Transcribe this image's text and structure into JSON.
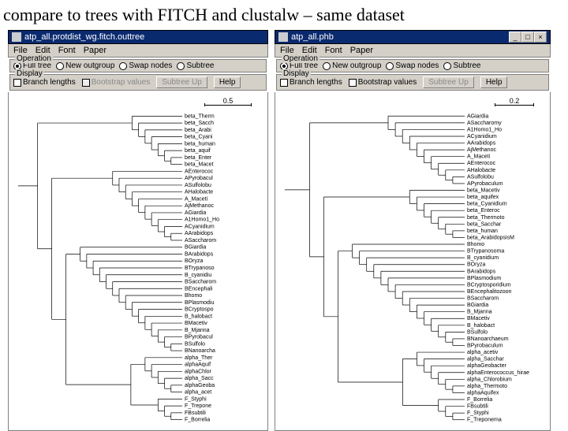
{
  "slide": {
    "title": "compare to trees with FITCH and clustalw – same dataset"
  },
  "left": {
    "titlebar": "atp_all.protdist_wg.fitch.outtree",
    "menu": [
      "File",
      "Edit",
      "Font",
      "Paper"
    ],
    "op_legend": "Operation",
    "ops": [
      "Full tree",
      "New outgroup",
      "Swap nodes",
      "Subtree"
    ],
    "op_sel": 0,
    "disp_legend": "Display",
    "branch_lbl": "Branch lengths",
    "boot_lbl": "Bootstrap values",
    "btn_up": "Subtree Up",
    "btn_help": "Help",
    "scale": "0.5",
    "taxa": [
      "beta_Therm",
      "beta_Sacch",
      "beta_Arabi",
      "beta_Cyani",
      "beta_human",
      "beta_aquif",
      "beta_Enter",
      "beta_Macet",
      "AEnterococ",
      "APyrobacul",
      "ASulfolobu",
      "AHalobacte",
      "A_Maceti",
      "AjMethanoc",
      "AGiardia",
      "A1Homo1_Ho",
      "ACyanidium",
      "AArabidops",
      "ASaccharom",
      "BGiardia",
      "BArabidops",
      "BOryza",
      "BTrypanoso",
      "B_cyanidiu",
      "BSaccharom",
      "BEncephali",
      "Bhomo",
      "BPlasmodiu",
      "BCryptospo",
      "B_halobact",
      "BMacetiv",
      "B_Mjanna",
      "BPyrobacul",
      "BSulfolo",
      "BNanoarcha",
      "alpha_Ther",
      "alphaAquif",
      "alphaChlor",
      "alpha_Sacc",
      "alphaGeoba",
      "alpha_acet",
      "F_Styphi",
      "F_Trepone",
      "FBsubtili",
      "F_Borrelia"
    ]
  },
  "right": {
    "titlebar": "atp_all.phb",
    "menu": [
      "File",
      "Edit",
      "Font",
      "Paper"
    ],
    "op_legend": "Operation",
    "ops": [
      "Full tree",
      "New outgroup",
      "Swap nodes",
      "Subtree"
    ],
    "op_sel": 0,
    "disp_legend": "Display",
    "branch_lbl": "Branch lengths",
    "boot_lbl": "Bootstrap values",
    "btn_up": "Subtree Up",
    "btn_help": "Help",
    "scale": "0.2",
    "taxa": [
      "AGiardia",
      "ASaccharomy",
      "A1Homo1_Ho",
      "ACyanidium",
      "AArabidops",
      "AjMethanoc",
      "A_Maceti",
      "AEnterococ",
      "AHalobacte",
      "ASulfolobu",
      "APyrobaculum",
      "beta_Macetiv",
      "beta_aquifex",
      "beta_Cyanidium",
      "beta_Enteroc",
      "beta_Thermoto",
      "beta_Sacchar",
      "beta_human",
      "beta_ArabidopsisM",
      "Bhomo",
      "BTrypanosoma",
      "B_cyanidium",
      "BOryza",
      "BArabidops",
      "BPlasmodium",
      "BCryptosporidium",
      "BEncephalitozoon",
      "BSaccharom",
      "BGiardia",
      "B_Mjanna",
      "BMacetiv",
      "B_halobact",
      "BSulfolo",
      "BNanoarchaeum",
      "BPyrobaculum",
      "alpha_acetiv",
      "alpha_Sacchar",
      "alphaGeobacter",
      "alphaEnterococcus_hirae",
      "alpha_Chlorobium",
      "alpha_Thermoto",
      "alphaAquifex",
      "F_Borrelia",
      "FBsubtili",
      "F_Styphi",
      "F_Treponema"
    ]
  },
  "sys": {
    "min": "_",
    "max": "□",
    "close": "×"
  },
  "chart_data": [
    {
      "type": "dendrogram",
      "title": "atp_all.protdist_wg.fitch.outtree",
      "scale_bar": 0.5,
      "branch_lengths_shown": false,
      "bootstrap_shown": false,
      "leaves": [
        "beta_Therm",
        "beta_Sacch",
        "beta_Arabi",
        "beta_Cyani",
        "beta_human",
        "beta_aquif",
        "beta_Enter",
        "beta_Macet",
        "AEnterococ",
        "APyrobacul",
        "ASulfolobu",
        "AHalobacte",
        "A_Maceti",
        "AjMethanoc",
        "AGiardia",
        "A1Homo1_Ho",
        "ACyanidium",
        "AArabidops",
        "ASaccharom",
        "BGiardia",
        "BArabidops",
        "BOryza",
        "BTrypanoso",
        "B_cyanidiu",
        "BSaccharom",
        "BEncephali",
        "Bhomo",
        "BPlasmodiu",
        "BCryptospo",
        "B_halobact",
        "BMacetiv",
        "B_Mjanna",
        "BPyrobacul",
        "BSulfolo",
        "BNanoarcha",
        "alpha_Ther",
        "alphaAquif",
        "alphaChlor",
        "alpha_Sacc",
        "alphaGeoba",
        "alpha_acet",
        "F_Styphi",
        "F_Trepone",
        "FBsubtili",
        "F_Borrelia"
      ],
      "clusters": [
        {
          "name": "beta",
          "members": [
            "beta_Therm",
            "beta_Sacch",
            "beta_Arabi",
            "beta_Cyani",
            "beta_human",
            "beta_aquif",
            "beta_Enter",
            "beta_Macet"
          ]
        },
        {
          "name": "A",
          "members": [
            "AEnterococ",
            "APyrobacul",
            "ASulfolobu",
            "AHalobacte",
            "A_Maceti",
            "AjMethanoc",
            "AGiardia",
            "A1Homo1_Ho",
            "ACyanidium",
            "AArabidops",
            "ASaccharom"
          ]
        },
        {
          "name": "B",
          "members": [
            "BGiardia",
            "BArabidops",
            "BOryza",
            "BTrypanoso",
            "B_cyanidiu",
            "BSaccharom",
            "BEncephali",
            "Bhomo",
            "BPlasmodiu",
            "BCryptospo",
            "B_halobact",
            "BMacetiv",
            "B_Mjanna",
            "BPyrobacul",
            "BSulfolo",
            "BNanoarcha"
          ]
        },
        {
          "name": "alpha",
          "members": [
            "alpha_Ther",
            "alphaAquif",
            "alphaChlor",
            "alpha_Sacc",
            "alphaGeoba",
            "alpha_acet"
          ]
        },
        {
          "name": "F",
          "members": [
            "F_Styphi",
            "F_Trepone",
            "FBsubtili",
            "F_Borrelia"
          ]
        }
      ]
    },
    {
      "type": "dendrogram",
      "title": "atp_all.phb",
      "scale_bar": 0.2,
      "branch_lengths_shown": false,
      "bootstrap_shown": false,
      "leaves": [
        "AGiardia",
        "ASaccharomy",
        "A1Homo1_Ho",
        "ACyanidium",
        "AArabidops",
        "AjMethanoc",
        "A_Maceti",
        "AEnterococ",
        "AHalobacte",
        "ASulfolobu",
        "APyrobaculum",
        "beta_Macetiv",
        "beta_aquifex",
        "beta_Cyanidium",
        "beta_Enteroc",
        "beta_Thermoto",
        "beta_Sacchar",
        "beta_human",
        "beta_ArabidopsisM",
        "Bhomo",
        "BTrypanosoma",
        "B_cyanidium",
        "BOryza",
        "BArabidops",
        "BPlasmodium",
        "BCryptosporidium",
        "BEncephalitozoon",
        "BSaccharom",
        "BGiardia",
        "B_Mjanna",
        "BMacetiv",
        "B_halobact",
        "BSulfolo",
        "BNanoarchaeum",
        "BPyrobaculum",
        "alpha_acetiv",
        "alpha_Sacchar",
        "alphaGeobacter",
        "alphaEnterococcus_hirae",
        "alpha_Chlorobium",
        "alpha_Thermoto",
        "alphaAquifex",
        "F_Borrelia",
        "FBsubtili",
        "F_Styphi",
        "F_Treponema"
      ],
      "clusters": [
        {
          "name": "A",
          "members": [
            "AGiardia",
            "ASaccharomy",
            "A1Homo1_Ho",
            "ACyanidium",
            "AArabidops",
            "AjMethanoc",
            "A_Maceti",
            "AEnterococ",
            "AHalobacte",
            "ASulfolobu",
            "APyrobaculum"
          ]
        },
        {
          "name": "beta",
          "members": [
            "beta_Macetiv",
            "beta_aquifex",
            "beta_Cyanidium",
            "beta_Enteroc",
            "beta_Thermoto",
            "beta_Sacchar",
            "beta_human",
            "beta_ArabidopsisM"
          ]
        },
        {
          "name": "B",
          "members": [
            "Bhomo",
            "BTrypanosoma",
            "B_cyanidium",
            "BOryza",
            "BArabidops",
            "BPlasmodium",
            "BCryptosporidium",
            "BEncephalitozoon",
            "BSaccharom",
            "BGiardia",
            "B_Mjanna",
            "BMacetiv",
            "B_halobact",
            "BSulfolo",
            "BNanoarchaeum",
            "BPyrobaculum"
          ]
        },
        {
          "name": "alpha",
          "members": [
            "alpha_acetiv",
            "alpha_Sacchar",
            "alphaGeobacter",
            "alphaEnterococcus_hirae",
            "alpha_Chlorobium",
            "alpha_Thermoto",
            "alphaAquifex"
          ]
        },
        {
          "name": "F",
          "members": [
            "F_Borrelia",
            "FBsubtili",
            "F_Styphi",
            "F_Treponema"
          ]
        }
      ]
    }
  ]
}
